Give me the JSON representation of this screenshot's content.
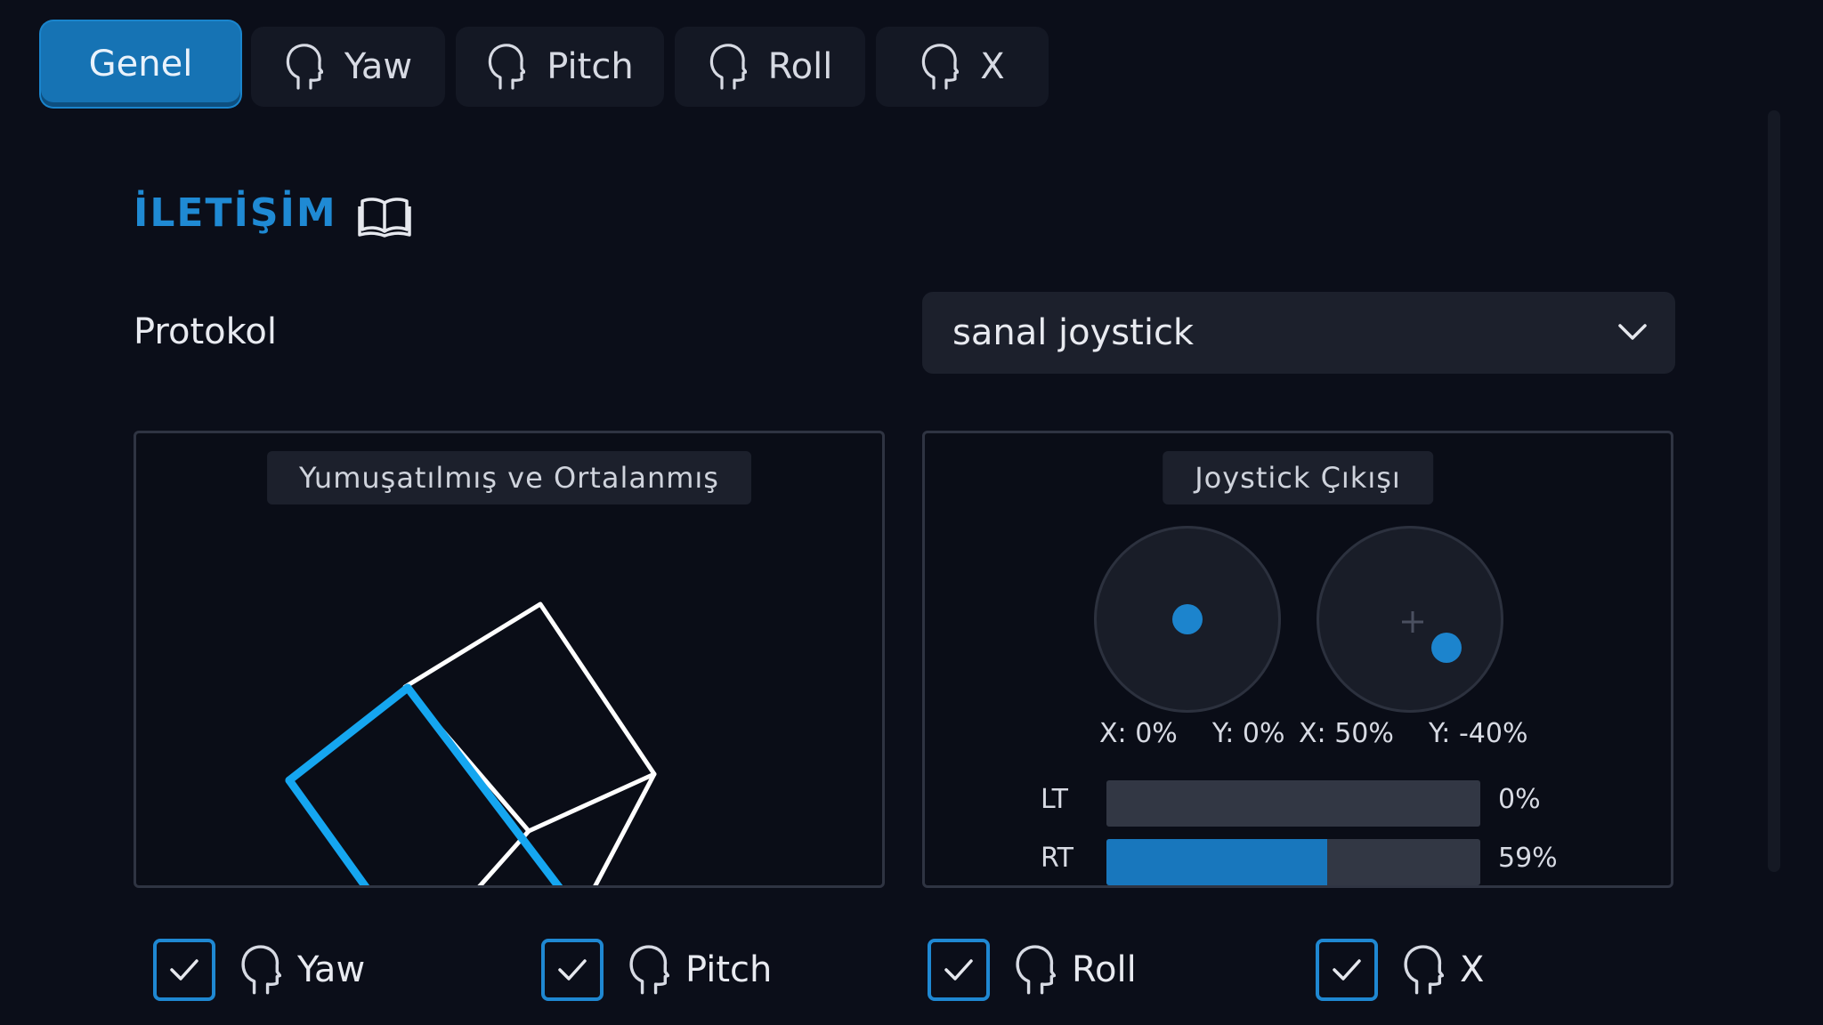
{
  "tabs": [
    {
      "label": "Genel",
      "active": true,
      "icon": ""
    },
    {
      "label": "Yaw",
      "active": false,
      "icon": "head-icon"
    },
    {
      "label": "Pitch",
      "active": false,
      "icon": "head-icon"
    },
    {
      "label": "Roll",
      "active": false,
      "icon": "head-icon"
    },
    {
      "label": "X",
      "active": false,
      "icon": "head-icon"
    }
  ],
  "section": {
    "title": "İLETİŞİM",
    "icon": "book-icon"
  },
  "protocol": {
    "label": "Protokol",
    "value": "sanal joystick"
  },
  "left_panel": {
    "title": "Yumuşatılmış ve Ortalanmış"
  },
  "right_panel": {
    "title": "Joystick Çıkışı",
    "sticks": [
      {
        "x_label": "X: 0%",
        "y_label": "Y: 0%",
        "x": 0,
        "y": 0
      },
      {
        "x_label": "X: 50%",
        "y_label": "Y: -40%",
        "x": 0.5,
        "y": -0.4
      }
    ],
    "triggers": [
      {
        "label": "LT",
        "value": "0%",
        "level": 0
      },
      {
        "label": "RT",
        "value": "59%",
        "level": 0.59
      }
    ]
  },
  "checkboxes": [
    {
      "label": "Yaw",
      "checked": true
    },
    {
      "label": "Pitch",
      "checked": true
    },
    {
      "label": "Roll",
      "checked": true
    },
    {
      "label": "X",
      "checked": true
    }
  ],
  "colors": {
    "accent": "#1f88d2",
    "background": "#0b0e19",
    "panel": "#1c202c"
  }
}
